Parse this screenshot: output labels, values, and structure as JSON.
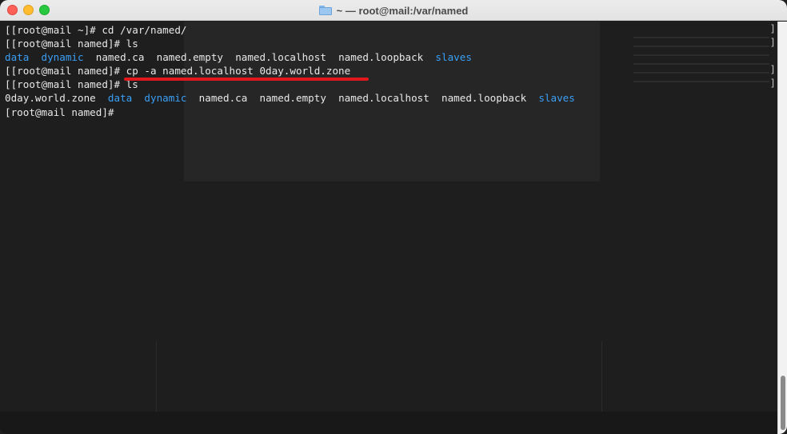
{
  "window": {
    "title": "~ — root@mail:/var/named"
  },
  "terminal": {
    "lines": [
      {
        "prompt": "[[root@mail ~]# ",
        "command": "cd /var/named/"
      },
      {
        "prompt": "[[root@mail named]# ",
        "command": "ls"
      },
      {
        "entries": [
          {
            "text": "data",
            "dir": true
          },
          {
            "text": "dynamic",
            "dir": true
          },
          {
            "text": "named.ca",
            "dir": false
          },
          {
            "text": "named.empty",
            "dir": false
          },
          {
            "text": "named.localhost",
            "dir": false
          },
          {
            "text": "named.loopback",
            "dir": false
          },
          {
            "text": "slaves",
            "dir": true
          }
        ]
      },
      {
        "prompt": "[[root@mail named]# ",
        "command": "cp -a named.localhost 0day.world.zone"
      },
      {
        "prompt": "[[root@mail named]# ",
        "command": "ls"
      },
      {
        "entries": [
          {
            "text": "0day.world.zone",
            "dir": false
          },
          {
            "text": "data",
            "dir": true
          },
          {
            "text": "dynamic",
            "dir": true
          },
          {
            "text": "named.ca",
            "dir": false
          },
          {
            "text": "named.empty",
            "dir": false
          },
          {
            "text": "named.localhost",
            "dir": false
          },
          {
            "text": "named.loopback",
            "dir": false
          },
          {
            "text": "slaves",
            "dir": true
          }
        ]
      },
      {
        "prompt": "[root@mail named]# ",
        "command": ""
      }
    ],
    "edge_marks": [
      "]",
      "]",
      "",
      "]",
      "]"
    ]
  },
  "colors": {
    "directory": "#3a9ff5",
    "highlight_underline": "#e3181d",
    "background": "#1e1e1e"
  },
  "icons": {
    "title_icon": "folder-icon"
  }
}
